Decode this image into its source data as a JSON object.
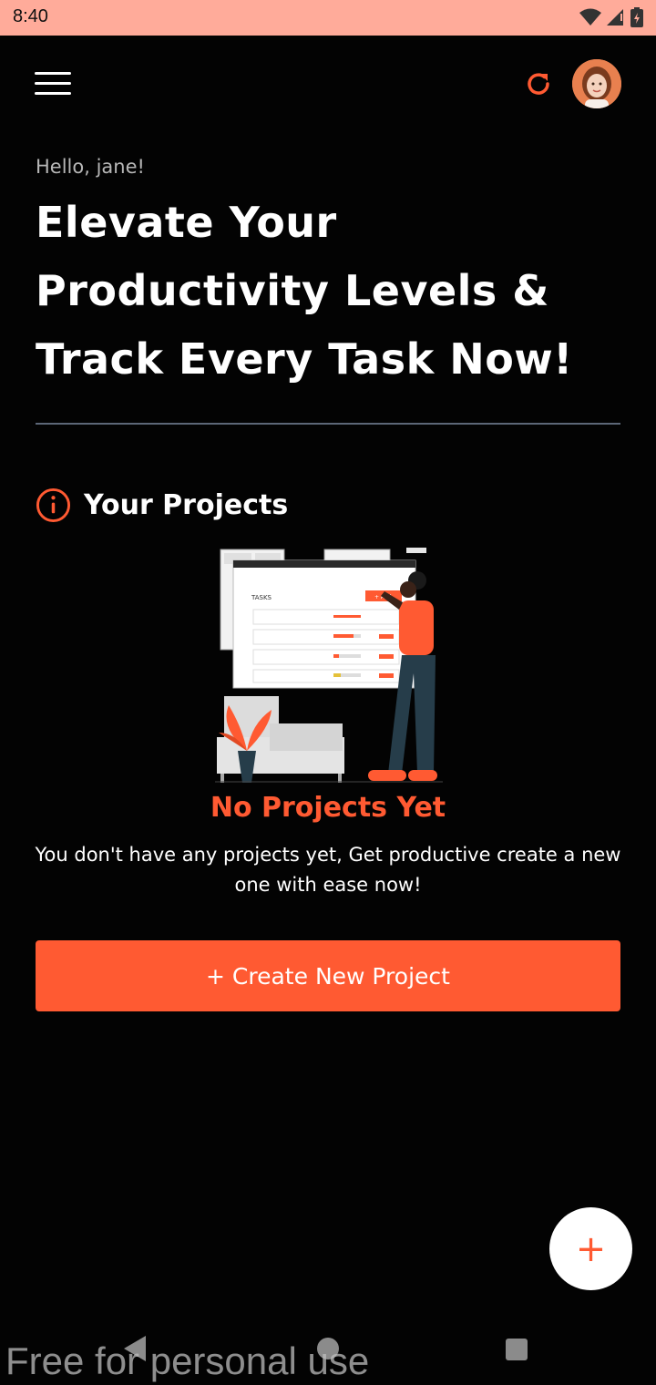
{
  "status_bar": {
    "time": "8:40",
    "icons": [
      "wifi-icon",
      "signal-icon",
      "battery-icon"
    ]
  },
  "header": {
    "menu_icon": "hamburger-menu-icon",
    "refresh_icon": "refresh-icon",
    "avatar": "user-avatar"
  },
  "hero": {
    "greeting": "Hello, jane!",
    "headline": "Elevate Your Productivity Levels & Track Every Task Now!"
  },
  "projects": {
    "section_icon": "info-icon",
    "title": "Your Projects",
    "illustration": {
      "board_title": "TASKS",
      "add_label": "+ Add"
    },
    "empty_title": "No Projects Yet",
    "empty_description": "You don't have any projects yet, Get productive create a new one with ease now!",
    "create_button": "+ Create New Project"
  },
  "fab": {
    "label": "+"
  },
  "nav_bar": {
    "back": "back-icon",
    "home": "home-icon",
    "recents": "recents-icon"
  },
  "watermark": "Free for personal use",
  "colors": {
    "accent": "#ff5a32",
    "background": "#030303",
    "status_bar": "#ffab9a",
    "divider": "#5c6677"
  }
}
